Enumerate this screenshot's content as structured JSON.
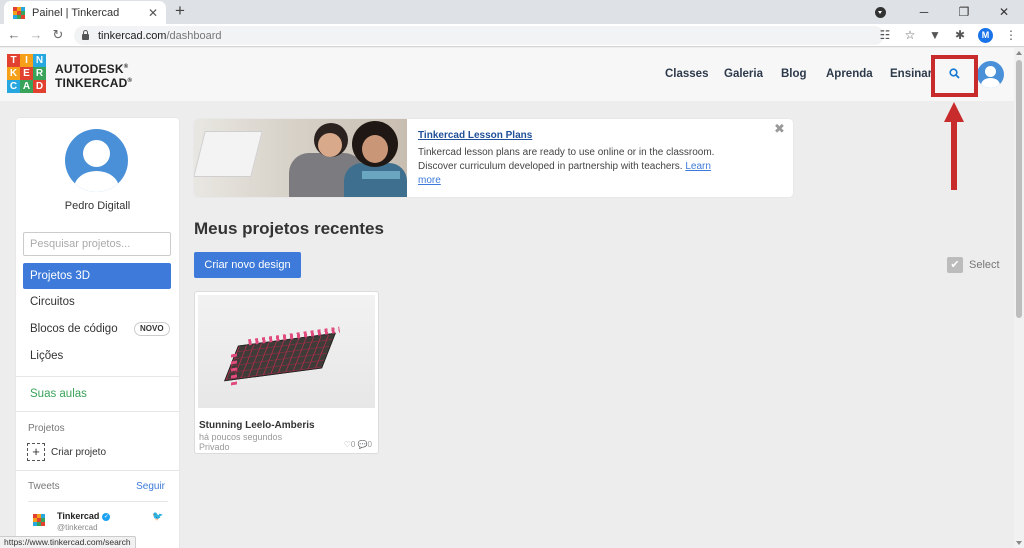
{
  "browser": {
    "tab_title": "Painel | Tinkercad",
    "tab_close": "✕",
    "new_tab": "+",
    "url_host": "tinkercad.com",
    "url_path": "/dashboard",
    "profile_initial": "M",
    "window_controls": [
      "─",
      "❐",
      "✕"
    ],
    "nav_icons": [
      "arrow-left-icon",
      "arrow-right-icon",
      "reload-icon"
    ]
  },
  "header": {
    "logo_letters": [
      "T",
      "I",
      "N",
      "K",
      "E",
      "R",
      "C",
      "A",
      "D"
    ],
    "logo_colors": [
      "#e2412f",
      "#f6a019",
      "#27a7df",
      "#f6a019",
      "#e2412f",
      "#3aa35a",
      "#27a7df",
      "#3aa35a",
      "#e2412f"
    ],
    "brand_line1": "AUTODESK",
    "brand_line2": "TINKERCAD",
    "brand_mark": "®",
    "nav": [
      "Classes",
      "Galeria",
      "Blog",
      "Aprenda",
      "Ensinar"
    ],
    "search_glyph": "⚲",
    "highlight_color": "#c72b2b"
  },
  "sidebar": {
    "user_name": "Pedro Digitall",
    "search_placeholder": "Pesquisar projetos...",
    "items": [
      {
        "label": "Projetos 3D",
        "active": true
      },
      {
        "label": "Circuitos"
      },
      {
        "label": "Blocos de código",
        "badge": "NOVO"
      },
      {
        "label": "Lições"
      }
    ],
    "classes_label": "Suas aulas",
    "projects_heading": "Projetos",
    "create_project_plus": "+",
    "create_project": "Criar projeto",
    "tweets_label": "Tweets",
    "follow_label": "Seguir",
    "tweet_author": "Tinkercad",
    "tweet_handle": "@tinkercad",
    "tweet_verified": "✓",
    "tweet_bird": "🐦"
  },
  "banner": {
    "title": "Tinkercad Lesson Plans",
    "text": "Tinkercad lesson plans are ready to use online or in the classroom. Discover curriculum developed in partnership with teachers.",
    "link": "Learn more",
    "close": "✖"
  },
  "main": {
    "heading": "Meus projetos recentes",
    "create_button": "Criar novo design",
    "select_label": "Select",
    "select_check": "✔",
    "accent_color": "#3d7ad9"
  },
  "projects": [
    {
      "title": "Stunning Leelo-Amberis",
      "time": "há poucos segundos",
      "privacy": "Privado",
      "likes": "♡0",
      "comments": "💬0"
    }
  ],
  "status_url": "https://www.tinkercad.com/search"
}
